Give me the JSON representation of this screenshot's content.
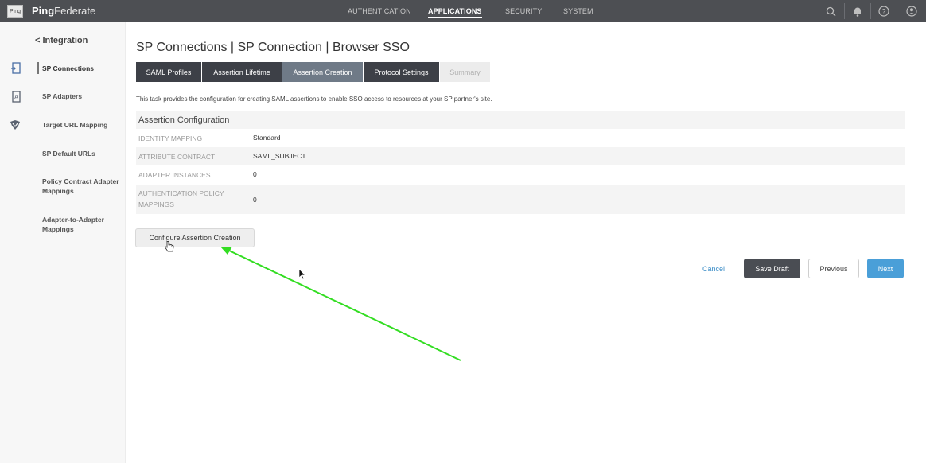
{
  "header": {
    "logo_text": "Ping",
    "app_name_bold": "Ping",
    "app_name_rest": "Federate",
    "nav": [
      {
        "label": "AUTHENTICATION",
        "active": false
      },
      {
        "label": "APPLICATIONS",
        "active": true
      },
      {
        "label": "SECURITY",
        "active": false
      },
      {
        "label": "SYSTEM",
        "active": false
      }
    ],
    "icons": [
      "search-icon",
      "bell-icon",
      "help-icon",
      "user-icon"
    ]
  },
  "rail": {
    "icons": [
      "sp-connections-icon",
      "sp-adapters-icon",
      "mapping-icon"
    ]
  },
  "sidebar": {
    "back_label": "< Integration",
    "items": [
      {
        "label": "SP Connections",
        "selected": true
      },
      {
        "label": "SP Adapters",
        "selected": false
      },
      {
        "label": "Target URL Mapping",
        "selected": false
      },
      {
        "label": "SP Default URLs",
        "selected": false
      },
      {
        "label": "Policy Contract Adapter Mappings",
        "selected": false
      },
      {
        "label": "Adapter-to-Adapter Mappings",
        "selected": false
      }
    ]
  },
  "main": {
    "title": "SP Connections | SP Connection | Browser SSO",
    "tabs": [
      {
        "label": "SAML Profiles",
        "state": "complete"
      },
      {
        "label": "Assertion Lifetime",
        "state": "complete"
      },
      {
        "label": "Assertion Creation",
        "state": "current"
      },
      {
        "label": "Protocol Settings",
        "state": "complete"
      },
      {
        "label": "Summary",
        "state": "disabled"
      }
    ],
    "description": "This task provides the configuration for creating SAML assertions to enable SSO access to resources at your SP partner's site.",
    "section_title": "Assertion Configuration",
    "rows": [
      {
        "label": "IDENTITY MAPPING",
        "value": "Standard"
      },
      {
        "label": "ATTRIBUTE CONTRACT",
        "value": "SAML_SUBJECT"
      },
      {
        "label": "ADAPTER INSTANCES",
        "value": "0"
      },
      {
        "label": "AUTHENTICATION POLICY MAPPINGS",
        "value": "0"
      }
    ],
    "configure_button": "Configure Assertion Creation"
  },
  "footer": {
    "cancel": "Cancel",
    "save_draft": "Save Draft",
    "previous": "Previous",
    "next": "Next"
  },
  "colors": {
    "topbar": "#4d4f53",
    "tab_dark": "#3d4047",
    "tab_current": "#6f7a87",
    "accent_blue": "#4a9fd8",
    "annotation_arrow": "#33dd22"
  }
}
